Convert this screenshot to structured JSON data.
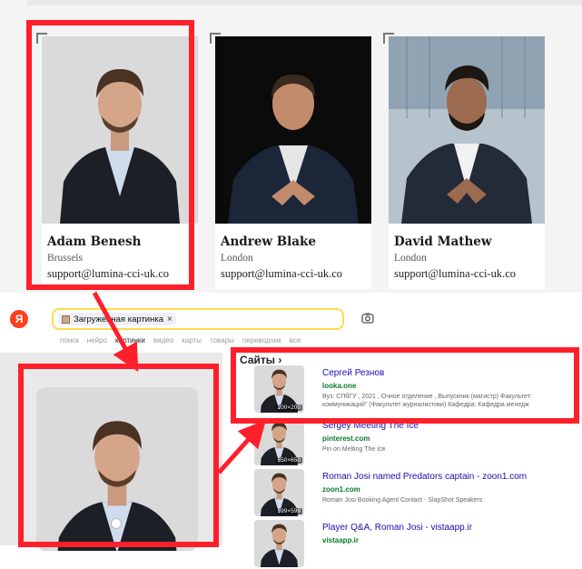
{
  "team": [
    {
      "name": "Adam Benesh",
      "city": "Brussels",
      "email": "support@lumina-cci-uk.co"
    },
    {
      "name": "Andrew Blake",
      "city": "London",
      "email": "support@lumina-cci-uk.co"
    },
    {
      "name": "David Mathew",
      "city": "London",
      "email": "support@lumina-cci-uk.co"
    }
  ],
  "yandex": {
    "logo": "Я",
    "chip_label": "Загруженная картинка",
    "chip_close": "×",
    "tabs": [
      "поиск",
      "нейро",
      "картинки",
      "видео",
      "карты",
      "товары",
      "переводчик",
      "все"
    ],
    "active_tab": "картинки",
    "sites_header": "Сайты",
    "results": [
      {
        "title": "Сергей Резнов",
        "host": "looka.one",
        "desc": "Вуз: СПбГУ , 2021 , Очное отделение , Выпускник (магистр) Факультет: коммуникаций\" (Факультет журналистики) Кафедра: Кафедра менедж",
        "size": "200×200"
      },
      {
        "title": "Sergey Meeting The Ice",
        "host": "pinterest.com",
        "desc": "Pin on Melting The Ice",
        "size": "550×650"
      },
      {
        "title": "Roman Josi named Predators captain - zoon1.com",
        "host": "zoon1.com",
        "desc": "Roman Josi Booking Agent Contact - SlapShot Speakers",
        "size": "599×599"
      },
      {
        "title": "Player Q&A, Roman Josi - vistaapp.ir",
        "host": "vistaapp.ir",
        "desc": "",
        "size": ""
      }
    ]
  },
  "colors": {
    "annotation": "#ff1f2a",
    "yandex_red": "#fc3f1d",
    "search_border": "#ffdb4d",
    "link": "#1a0dab",
    "host": "#0a7a2a"
  }
}
